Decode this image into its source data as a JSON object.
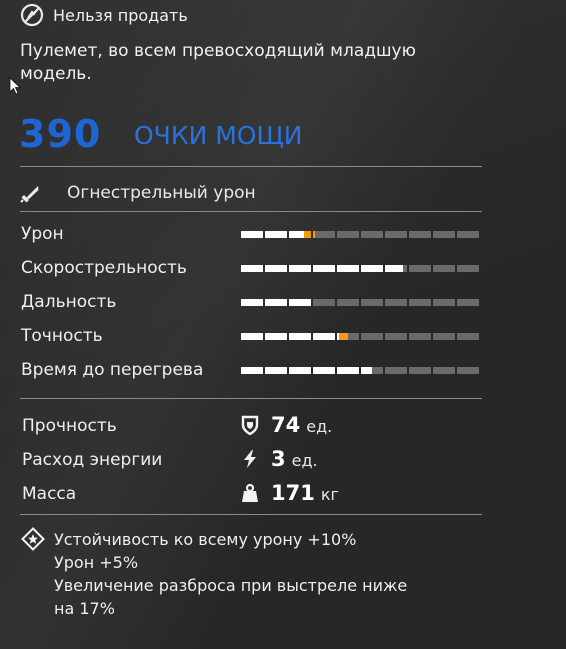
{
  "item": {
    "tag_label": "Нельзя продать",
    "tag_icon": "no-sell-icon",
    "description": "Пулемет, во всем превосходящий младшую модель.",
    "power_value": "390",
    "power_label": "ОЧКИ МОЩИ",
    "damage_type": "Огнестрельный урон",
    "damage_icon": "bullet-icon",
    "accent_color": "#1f66d4",
    "bonus_color": "#f39c12"
  },
  "stats": [
    {
      "label": "Урон",
      "value": 0.27,
      "bonus": 0.04
    },
    {
      "label": "Скорострельность",
      "value": 0.68,
      "bonus": 0
    },
    {
      "label": "Дальность",
      "value": 0.3,
      "bonus": 0
    },
    {
      "label": "Точность",
      "value": 0.41,
      "bonus": 0.04
    },
    {
      "label": "Время до перегрева",
      "value": 0.55,
      "bonus": 0
    }
  ],
  "properties": [
    {
      "label": "Прочность",
      "value": "74",
      "unit": "ед.",
      "icon": "shield-icon"
    },
    {
      "label": "Расход энергии",
      "value": "3",
      "unit": "ед.",
      "icon": "lightning-icon"
    },
    {
      "label": "Масса",
      "value": "171",
      "unit": "кг",
      "icon": "weight-icon"
    }
  ],
  "bonuses": {
    "icon": "star-diamond-icon",
    "lines": [
      "Устойчивость ко всему урону +10%",
      "Урон +5%",
      "Увеличение разброса при выстреле ниже",
      "на 17%"
    ]
  }
}
